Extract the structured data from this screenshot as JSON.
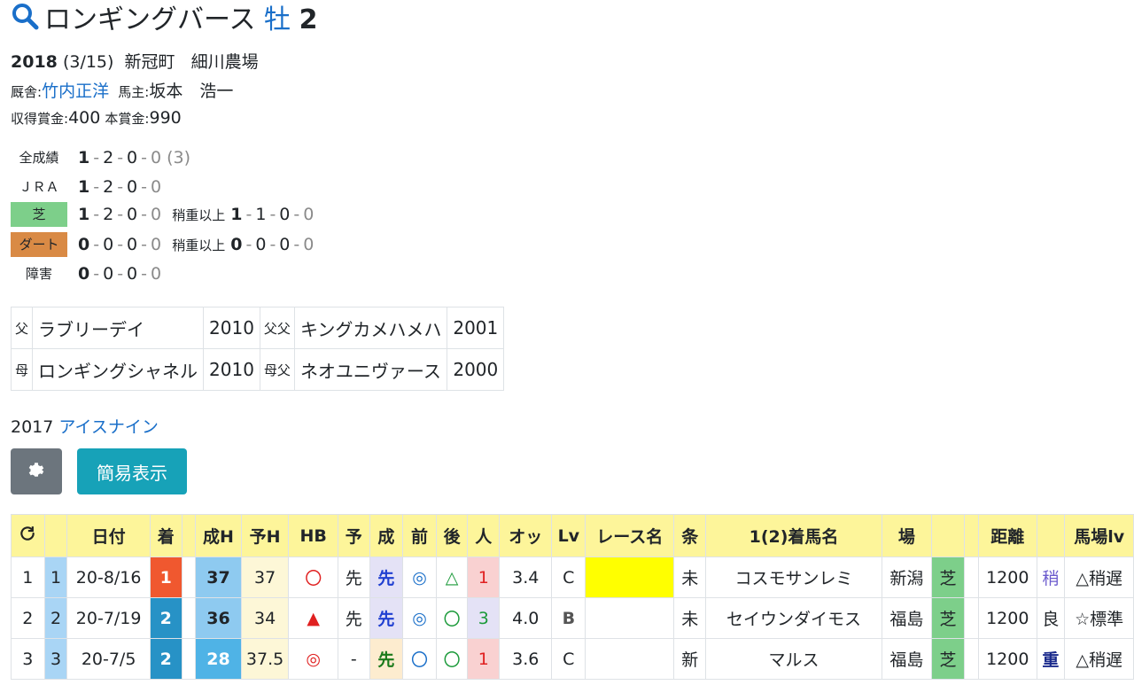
{
  "horse": {
    "name": "ロンギングバース",
    "sex": "牡",
    "age": "2"
  },
  "profile": {
    "year": "2018",
    "birthday": "(3/15)",
    "location": "新冠町",
    "breeder": "細川農場",
    "trainer_label": "厩舎:",
    "trainer": "竹内正洋",
    "owner_label": "馬主:",
    "owner": "坂本　浩一",
    "prize_acquired_label": "収得賞金:",
    "prize_acquired": "400",
    "prize_main_label": "本賞金:",
    "prize_main": "990"
  },
  "records": {
    "all": {
      "label": "全成績",
      "w": "1",
      "s": "2",
      "t": "0",
      "o": "0",
      "extra": "(3)"
    },
    "jra": {
      "label": "ＪＲＡ",
      "w": "1",
      "s": "2",
      "t": "0",
      "o": "0"
    },
    "turf": {
      "label": "芝",
      "w": "1",
      "s": "2",
      "t": "0",
      "o": "0",
      "heavy_label": "稍重以上",
      "hw": "1",
      "hs": "1",
      "ht": "0",
      "ho": "0"
    },
    "dirt": {
      "label": "ダート",
      "w": "0",
      "s": "0",
      "t": "0",
      "o": "0",
      "heavy_label": "稍重以上",
      "hw": "0",
      "hs": "0",
      "ht": "0",
      "ho": "0"
    },
    "jump": {
      "label": "障害",
      "w": "0",
      "s": "0",
      "t": "0",
      "o": "0"
    }
  },
  "pedigree": {
    "sire_label": "父",
    "sire": "ラブリーデイ",
    "sire_year": "2010",
    "sire_sire_label": "父父",
    "sire_sire": "キングカメハメハ",
    "sire_sire_year": "2001",
    "dam_label": "母",
    "dam": "ロンギングシャネル",
    "dam_year": "2010",
    "dam_sire_label": "母父",
    "dam_sire": "ネオユニヴァース",
    "dam_sire_year": "2000"
  },
  "sibling": {
    "year": "2017",
    "name": "アイスナイン"
  },
  "buttons": {
    "gear_icon": "gear-icon",
    "simple_label": "簡易表示"
  },
  "colors": {
    "link": "#1a6fc9",
    "turf": "#7dcf8a",
    "dirt": "#d98a45",
    "header": "#fdf59a",
    "gear_button": "#6c757d",
    "simple_button": "#17a2b8"
  },
  "table": {
    "headers": {
      "refresh_icon": "refresh-icon",
      "date": "日付",
      "finish": "着",
      "seiH": "成H",
      "yoH": "予H",
      "hb": "HB",
      "yo": "予",
      "sei": "成",
      "mae": "前",
      "ato": "後",
      "pop": "人",
      "odds": "オッ",
      "lv": "Lv",
      "race": "レース名",
      "cond": "条",
      "winner": "1(2)着馬名",
      "venue": "場",
      "dist": "距離",
      "track": "馬場lv"
    },
    "rows": [
      {
        "idx": "1",
        "no": "1",
        "date": "20-8/16",
        "finish": "1",
        "seiH": "37",
        "yoH": "37",
        "hb": "〇",
        "yo": "先",
        "sei": "先",
        "mae": "◎",
        "ato": "△",
        "pop": "1",
        "odds": "3.4",
        "lv": "C",
        "race": "",
        "cond": "未",
        "winner": "コスモサンレミ",
        "venue": "新潟",
        "surface": "芝",
        "dist": "1200",
        "going": "稍",
        "track": "△稍遅"
      },
      {
        "idx": "2",
        "no": "2",
        "date": "20-7/19",
        "finish": "2",
        "seiH": "36",
        "yoH": "34",
        "hb": "▲",
        "yo": "先",
        "sei": "先",
        "mae": "◎",
        "ato": "〇",
        "pop": "3",
        "odds": "4.0",
        "lv": "B",
        "race": "",
        "cond": "未",
        "winner": "セイウンダイモス",
        "venue": "福島",
        "surface": "芝",
        "dist": "1200",
        "going": "良",
        "track": "☆標準"
      },
      {
        "idx": "3",
        "no": "3",
        "date": "20-7/5",
        "finish": "2",
        "seiH": "28",
        "yoH": "37.5",
        "hb": "◎",
        "yo": "-",
        "sei": "先",
        "mae": "〇",
        "ato": "〇",
        "pop": "1",
        "odds": "3.6",
        "lv": "C",
        "race": "",
        "cond": "新",
        "winner": "マルス",
        "venue": "福島",
        "surface": "芝",
        "dist": "1200",
        "going": "重",
        "track": "△稍遅"
      }
    ]
  }
}
